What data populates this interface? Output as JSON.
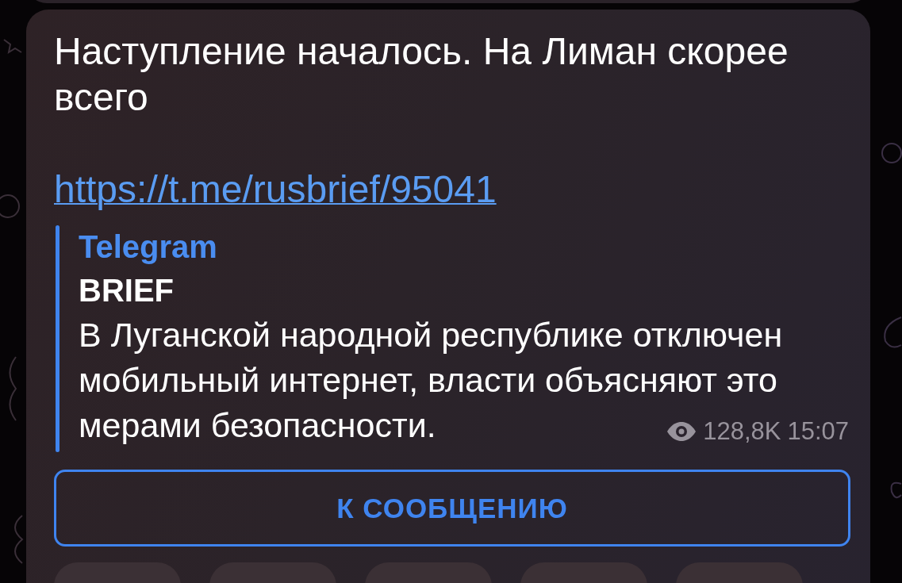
{
  "message": {
    "text": "Наступление началось. На Лиман скорее всего",
    "link": "https://t.me/rusbrief/95041",
    "preview": {
      "site": "Telegram",
      "title": "BRIEF",
      "description": "В Луганской народной республике отключен мобильный интернет, власти объясняют это мерами безопасности."
    },
    "views": "128,8K",
    "time": "15:07",
    "button": "К СООБЩЕНИЮ"
  }
}
